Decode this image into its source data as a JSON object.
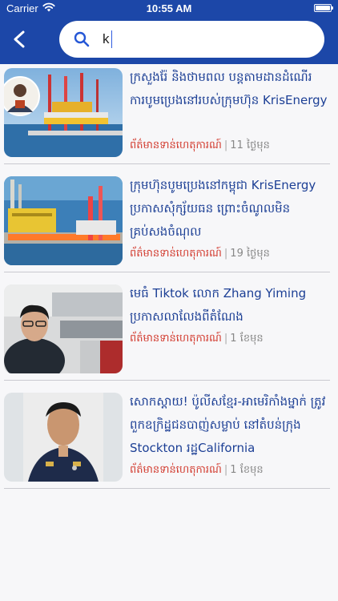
{
  "status_bar": {
    "carrier": "Carrier",
    "time": "10:55 AM"
  },
  "search": {
    "value": "k",
    "placeholder": ""
  },
  "colors": {
    "header": "#1c47a8",
    "title": "#1c3f95",
    "category": "#d23a2e",
    "meta": "#888888"
  },
  "articles": [
    {
      "title": "ក្រសួងរ៉ែ និងថាមពល បន្តតាមដានដំណើរការបូមប្រេងនៅរបស់ក្រុមហ៊ុន KrisEnergy",
      "category": "ព័ត៌មានទាន់ហេតុការណ៍",
      "time": "11 ថ្ងៃមុន",
      "image": "offshore-oil-rig-with-official-portrait"
    },
    {
      "title": "ក្រុមហ៊ុនបូមប្រេងនៅកម្ពុជា KrisEnergy ប្រកាសសុំក្ស័យធន ព្រោះចំណូលមិនគ្រប់សងចំណុល",
      "category": "ព័ត៌មានទាន់ហេតុការណ៍",
      "time": "19 ថ្ងៃមុន",
      "image": "oil-platform-at-sea"
    },
    {
      "title": "មេធំ Tiktok លោក Zhang Yiming ប្រកាសលាលែងពីតំណែង",
      "category": "ព័ត៌មានទាន់ហេតុការណ៍",
      "time": "1 ខែមុន",
      "image": "man-in-office"
    },
    {
      "title": "សោកស្តាយ! ប៉ូលីសខ្មែរ-អាមេរិកាំងម្នាក់ ត្រូវពួកឧក្រិដ្ឋជនបាញ់សម្លាប់ នៅតំបន់ក្រុង Stockton រដ្ឋCalifornia",
      "category": "ព័ត៌មានទាន់ហេតុការណ៍",
      "time": "1 ខែមុន",
      "image": "police-officer-portrait"
    }
  ]
}
